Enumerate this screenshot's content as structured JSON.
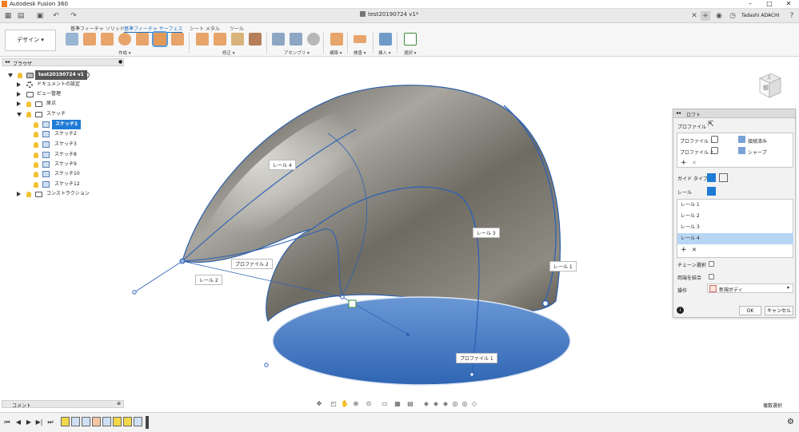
{
  "app": {
    "title": "Autodesk Fusion 360"
  },
  "document": {
    "name": "test20190724 v1*"
  },
  "user": {
    "name": "Tadashi ADACHI"
  },
  "ribbon": {
    "design_button": "デザイン",
    "tabs": [
      "基準フィーチャ ソリッド",
      "基準フィーチャ サーフェス",
      "シート メタル",
      "ツール"
    ],
    "active_tab_index": 1,
    "groups": [
      "作成",
      "修正",
      "アセンブリ",
      "構築",
      "検査",
      "挿入",
      "選択"
    ]
  },
  "browser": {
    "title": "ブラウザ",
    "root": "test20190724 v1",
    "items": [
      {
        "label": "ドキュメントの設定"
      },
      {
        "label": "ビュー管理"
      },
      {
        "label": "原点"
      },
      {
        "label": "スケッチ"
      },
      {
        "label": "スケッチ1"
      },
      {
        "label": "スケッチ2"
      },
      {
        "label": "スケッチ3"
      },
      {
        "label": "スケッチ8"
      },
      {
        "label": "スケッチ9"
      },
      {
        "label": "スケッチ10"
      },
      {
        "label": "スケッチ12"
      },
      {
        "label": "コンストラクション"
      }
    ]
  },
  "comments": {
    "title": "コメント"
  },
  "viewport": {
    "labels": {
      "rail1": "レール 1",
      "rail2": "レール 2",
      "rail3": "レール 3",
      "rail4": "レール 4",
      "profile1": "プロファイル 1",
      "profile2": "プロファイル 2"
    },
    "viewcube_face": "前",
    "viewcube_top": "上"
  },
  "loft": {
    "title": "ロフト",
    "profile_label": "プロファイル",
    "profiles": [
      {
        "name": "プロファイル 1",
        "type": "接続済み"
      },
      {
        "name": "プロファイル 2",
        "type": "シャープ"
      }
    ],
    "guide_type_label": "ガイド タイプ",
    "rail_label": "レール",
    "rails": [
      "レール 1",
      "レール 2",
      "レール 3",
      "レール 4"
    ],
    "selected_rail_index": 3,
    "chain_select_label": "チェーン選択",
    "merge_tangent_label": "両端を結合",
    "operation_label": "操作",
    "operation_value": "新規ボディ",
    "ok": "OK",
    "cancel": "キャンセル"
  },
  "status": {
    "object_select": "複数選択"
  }
}
